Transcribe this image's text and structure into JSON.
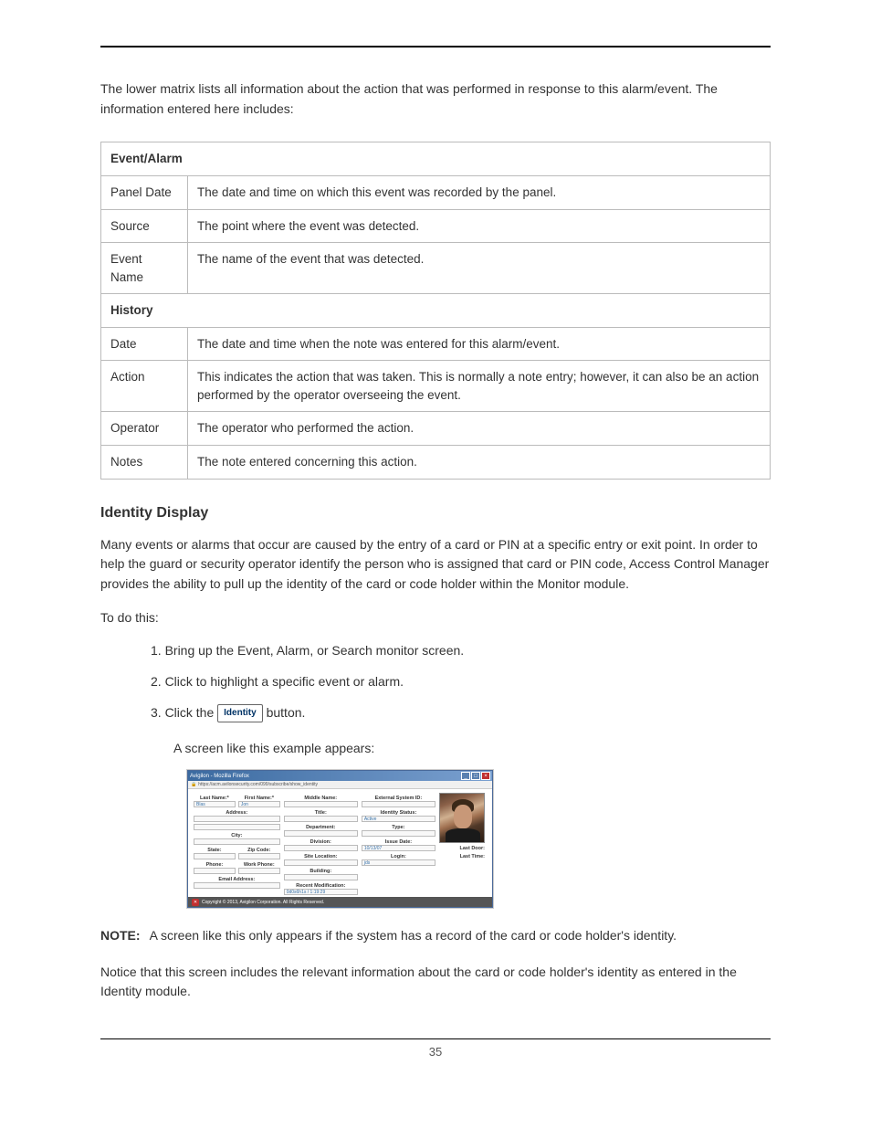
{
  "intro": "The lower matrix lists all information about the action that was performed in response to this alarm/event. The information entered here includes:",
  "table": {
    "section1_header": "Event/Alarm",
    "rows1": [
      {
        "label": "Panel Date",
        "desc": "The date and time on which this event was recorded by the panel."
      },
      {
        "label": "Source",
        "desc": "The point where the event was detected."
      },
      {
        "label": "Event Name",
        "desc": "The name of the event that was detected."
      }
    ],
    "section2_header": "History",
    "rows2": [
      {
        "label": "Date",
        "desc": "The date and time when the note was entered for this alarm/event."
      },
      {
        "label": "Action",
        "desc": "This indicates the action that was taken. This is normally a note entry; however, it can also be an action performed by the operator overseeing the event."
      },
      {
        "label": "Operator",
        "desc": "The operator who performed the action."
      },
      {
        "label": "Notes",
        "desc": "The note entered concerning this action."
      }
    ]
  },
  "subheading": "Identity Display",
  "sub_para": "Many events or alarms that occur are caused by the entry of a card or PIN at a specific entry or exit point. In order to help the guard or security operator identify the person who is assigned that card or PIN code, Access Control Manager provides the ability to pull up the identity of the card or code holder within the Monitor module.",
  "todo": "To do this:",
  "steps": {
    "s1": "1.  Bring up the Event, Alarm, or Search monitor screen.",
    "s2": "2.  Click to highlight a specific event or alarm.",
    "s3_pre": "3.  Click the ",
    "s3_btn": "Identity",
    "s3_post": " button.",
    "s3_sub": "A screen like this example appears:"
  },
  "mock": {
    "title": "Avigilon - Mozilla Firefox",
    "url": "https://acm.avilonsecurity.com/099/subscribe/show_identity",
    "labels": {
      "last_name": "Last Name:*",
      "first_name": "First Name:*",
      "middle_name": "Middle Name:",
      "external_id": "External System ID:",
      "address": "Address:",
      "title": "Title:",
      "identity_status": "Identity Status:",
      "department": "Department:",
      "type": "Type:",
      "city": "City:",
      "division": "Division:",
      "issue_date": "Issue Date:",
      "state": "State:",
      "zip": "Zip Code:",
      "site_location": "Site Location:",
      "login": "Login:",
      "phone": "Phone:",
      "work_phone": "Work Phone:",
      "building": "Building:",
      "email": "Email Address:",
      "recent_mod": "Recent Modification:",
      "last_door": "Last Door:",
      "last_time": "Last Time:"
    },
    "values": {
      "last_name": "Blas",
      "first_name": "Jon",
      "status": "Active",
      "issue_date": "10/13/07",
      "login": "jds",
      "recent_mod": "0d0s6h1s / 1:19:29"
    },
    "footer": "Copyright © 2013, Avigilon Corporation. All Rights Reserved."
  },
  "note_label": "NOTE:",
  "note_body": "A screen like this only appears if the system has a record of the card or code holder's identity.",
  "closing": "Notice that this screen includes the relevant information about the card or code holder's identity as entered in the Identity module.",
  "page_num": "35"
}
